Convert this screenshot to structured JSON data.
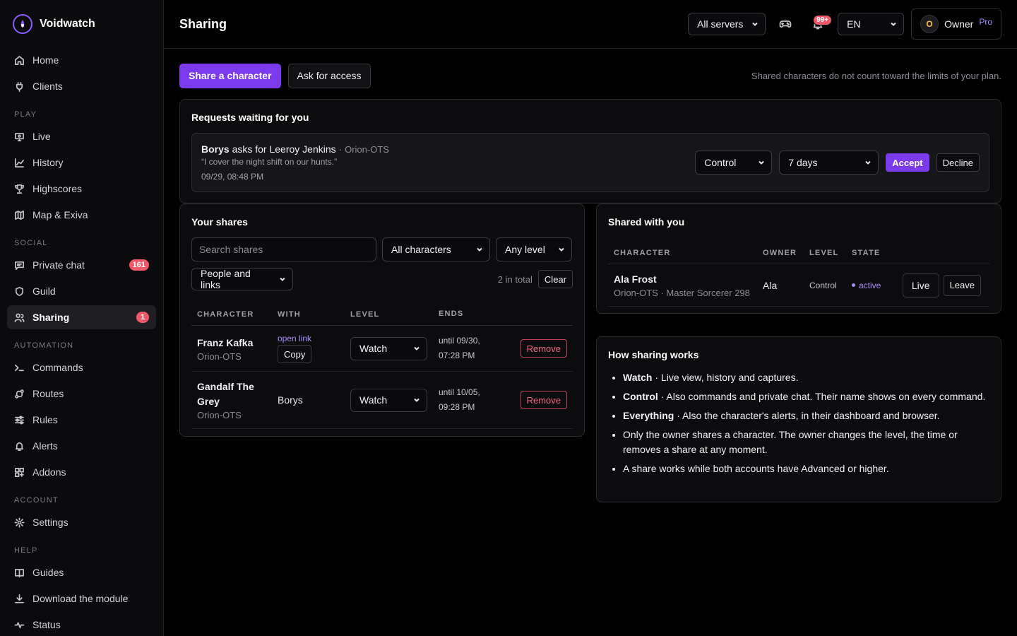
{
  "brand": {
    "name": "Voidwatch"
  },
  "sidebar": {
    "top": [
      {
        "label": "Home",
        "icon": "home-icon"
      },
      {
        "label": "Clients",
        "icon": "plug-icon"
      }
    ],
    "sections": [
      {
        "title": "PLAY",
        "items": [
          {
            "label": "Live",
            "icon": "monitor-icon"
          },
          {
            "label": "History",
            "icon": "chart-line-icon"
          },
          {
            "label": "Highscores",
            "icon": "trophy-icon"
          },
          {
            "label": "Map & Exiva",
            "icon": "map-icon"
          }
        ]
      },
      {
        "title": "SOCIAL",
        "items": [
          {
            "label": "Private chat",
            "icon": "chat-icon",
            "badge": "161"
          },
          {
            "label": "Guild",
            "icon": "shield-icon"
          },
          {
            "label": "Sharing",
            "icon": "users-icon",
            "badge": "1",
            "active": true
          }
        ]
      },
      {
        "title": "AUTOMATION",
        "items": [
          {
            "label": "Commands",
            "icon": "terminal-icon"
          },
          {
            "label": "Routes",
            "icon": "route-icon"
          },
          {
            "label": "Rules",
            "icon": "sliders-icon"
          },
          {
            "label": "Alerts",
            "icon": "bell-icon"
          },
          {
            "label": "Addons",
            "icon": "puzzle-icon"
          }
        ]
      },
      {
        "title": "ACCOUNT",
        "items": [
          {
            "label": "Settings",
            "icon": "gear-icon"
          }
        ]
      },
      {
        "title": "HELP",
        "items": [
          {
            "label": "Guides",
            "icon": "book-icon"
          },
          {
            "label": "Download the module",
            "icon": "download-icon"
          },
          {
            "label": "Status",
            "icon": "pulse-icon"
          }
        ]
      }
    ]
  },
  "header": {
    "title": "Sharing",
    "server_select": "All servers",
    "notifications_badge": "99+",
    "language": "EN",
    "owner": {
      "initial": "O",
      "name": "Owner",
      "plan": "Pro"
    }
  },
  "actions": {
    "share_label": "Share a character",
    "ask_label": "Ask for access",
    "plan_note": "Shared characters do not count toward the limits of your plan."
  },
  "requests": {
    "title": "Requests waiting for you",
    "item": {
      "requester": "Borys",
      "asks_for": " asks for ",
      "character": "Leeroy Jenkins",
      "separator": " · ",
      "server": "Orion-OTS",
      "message": "“I cover the night shift on our hunts.”",
      "time": "09/29, 08:48 PM",
      "level": "Control",
      "duration": "7 days",
      "accept_label": "Accept",
      "decline_label": "Decline"
    }
  },
  "your_shares": {
    "title": "Your shares",
    "search_placeholder": "Search shares",
    "filter_characters": "All characters",
    "filter_level": "Any level",
    "filter_people": "People and links",
    "total": "2 in total",
    "clear_label": "Clear",
    "columns": [
      "CHARACTER",
      "WITH",
      "LEVEL",
      "ENDS"
    ],
    "rows": [
      {
        "name": "Franz Kafka",
        "server": "Orion-OTS",
        "with_link": "open link",
        "with_copy": "Copy",
        "level": "Watch",
        "ends_1": "until 09/30,",
        "ends_2": "07:28 PM",
        "remove_label": "Remove"
      },
      {
        "name": "Gandalf The Grey",
        "server": "Orion-OTS",
        "with": "Borys",
        "level": "Watch",
        "ends_1": "until 10/05,",
        "ends_2": "09:28 PM",
        "remove_label": "Remove"
      }
    ]
  },
  "shared_with_you": {
    "title": "Shared with you",
    "columns": [
      "CHARACTER",
      "OWNER",
      "LEVEL",
      "STATE"
    ],
    "rows": [
      {
        "name": "Ala Frost",
        "sub": "Orion-OTS · Master Sorcerer 298",
        "owner": "Ala",
        "level": "Control",
        "state": "active",
        "live_label": "Live",
        "leave_label": "Leave"
      }
    ]
  },
  "how": {
    "title": "How sharing works",
    "items": [
      {
        "term": "Watch",
        "text": " · Live view, history and captures."
      },
      {
        "term": "Control",
        "text": " · Also commands and private chat. Their name shows on every command."
      },
      {
        "term": "Everything",
        "text": " · Also the character's alerts, in their dashboard and browser."
      },
      {
        "term": "",
        "text": "Only the owner shares a character. The owner changes the level, the time or removes a share at any moment."
      },
      {
        "term": "",
        "text": "A share works while both accounts have Advanced or higher."
      }
    ]
  },
  "colors": {
    "accent": "#7c3aed",
    "badge": "#f0586a",
    "link": "#a78bfa",
    "danger": "#f0687e"
  }
}
